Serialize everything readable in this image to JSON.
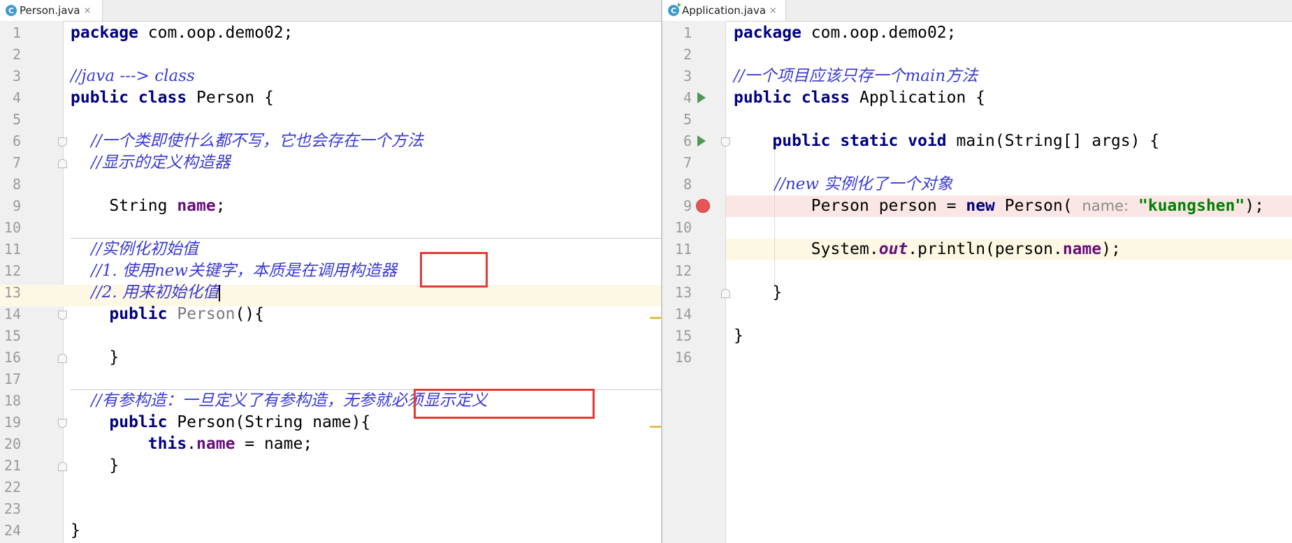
{
  "left": {
    "tab": {
      "icon": "c-class-icon",
      "label": "Person.java",
      "close": "×"
    },
    "lines": [
      {
        "n": "1",
        "t": "package com.oop.demo02;"
      },
      {
        "n": "2",
        "t": ""
      },
      {
        "n": "3",
        "t": "//java ---> class"
      },
      {
        "n": "4",
        "t": "public class Person {"
      },
      {
        "n": "5",
        "t": ""
      },
      {
        "n": "6",
        "t": "    //一个类即使什么都不写，它也会存在一个方法"
      },
      {
        "n": "7",
        "t": "    //显示的定义构造器"
      },
      {
        "n": "8",
        "t": ""
      },
      {
        "n": "9",
        "t": "    String name;"
      },
      {
        "n": "10",
        "t": ""
      },
      {
        "n": "11",
        "t": "    //实例化初始值"
      },
      {
        "n": "12",
        "t": "    //1. 使用new关键字，本质是在调用构造器"
      },
      {
        "n": "13",
        "t": "    //2. 用来初始化值"
      },
      {
        "n": "14",
        "t": "    public Person(){"
      },
      {
        "n": "15",
        "t": ""
      },
      {
        "n": "16",
        "t": "    }"
      },
      {
        "n": "17",
        "t": ""
      },
      {
        "n": "18",
        "t": "    //有参构造：一旦定义了有参构造，无参就必须显示定义"
      },
      {
        "n": "19",
        "t": "    public Person(String name){"
      },
      {
        "n": "20",
        "t": "        this.name = name;"
      },
      {
        "n": "21",
        "t": "    }"
      },
      {
        "n": "22",
        "t": ""
      },
      {
        "n": "23",
        "t": ""
      },
      {
        "n": "24",
        "t": "}"
      }
    ]
  },
  "right": {
    "tab": {
      "icon": "c-run-class-icon",
      "label": "Application.java",
      "close": "×"
    },
    "lines": [
      {
        "n": "1",
        "t": "package com.oop.demo02;"
      },
      {
        "n": "2",
        "t": ""
      },
      {
        "n": "3",
        "t": "//一个项目应该只存一个main方法"
      },
      {
        "n": "4",
        "t": "public class Application {"
      },
      {
        "n": "5",
        "t": ""
      },
      {
        "n": "6",
        "t": "    public static void main(String[] args) {"
      },
      {
        "n": "7",
        "t": ""
      },
      {
        "n": "8",
        "t": "        //new 实例化了一个对象"
      },
      {
        "n": "9",
        "t": "        Person person = new Person( name: \"kuangshen\");"
      },
      {
        "n": "10",
        "t": ""
      },
      {
        "n": "11",
        "t": "        System.out.println(person.name);"
      },
      {
        "n": "12",
        "t": ""
      },
      {
        "n": "13",
        "t": "    }"
      },
      {
        "n": "14",
        "t": ""
      },
      {
        "n": "15",
        "t": "}"
      },
      {
        "n": "16",
        "t": ""
      }
    ]
  },
  "colors": {
    "keyword": "#000080",
    "comment": "#3a3ad0",
    "field": "#660e7a",
    "string": "#008000",
    "annotation_box": "#e53935",
    "current_line": "#fdf8e4",
    "breakpoint_line": "#fbe6e6"
  }
}
